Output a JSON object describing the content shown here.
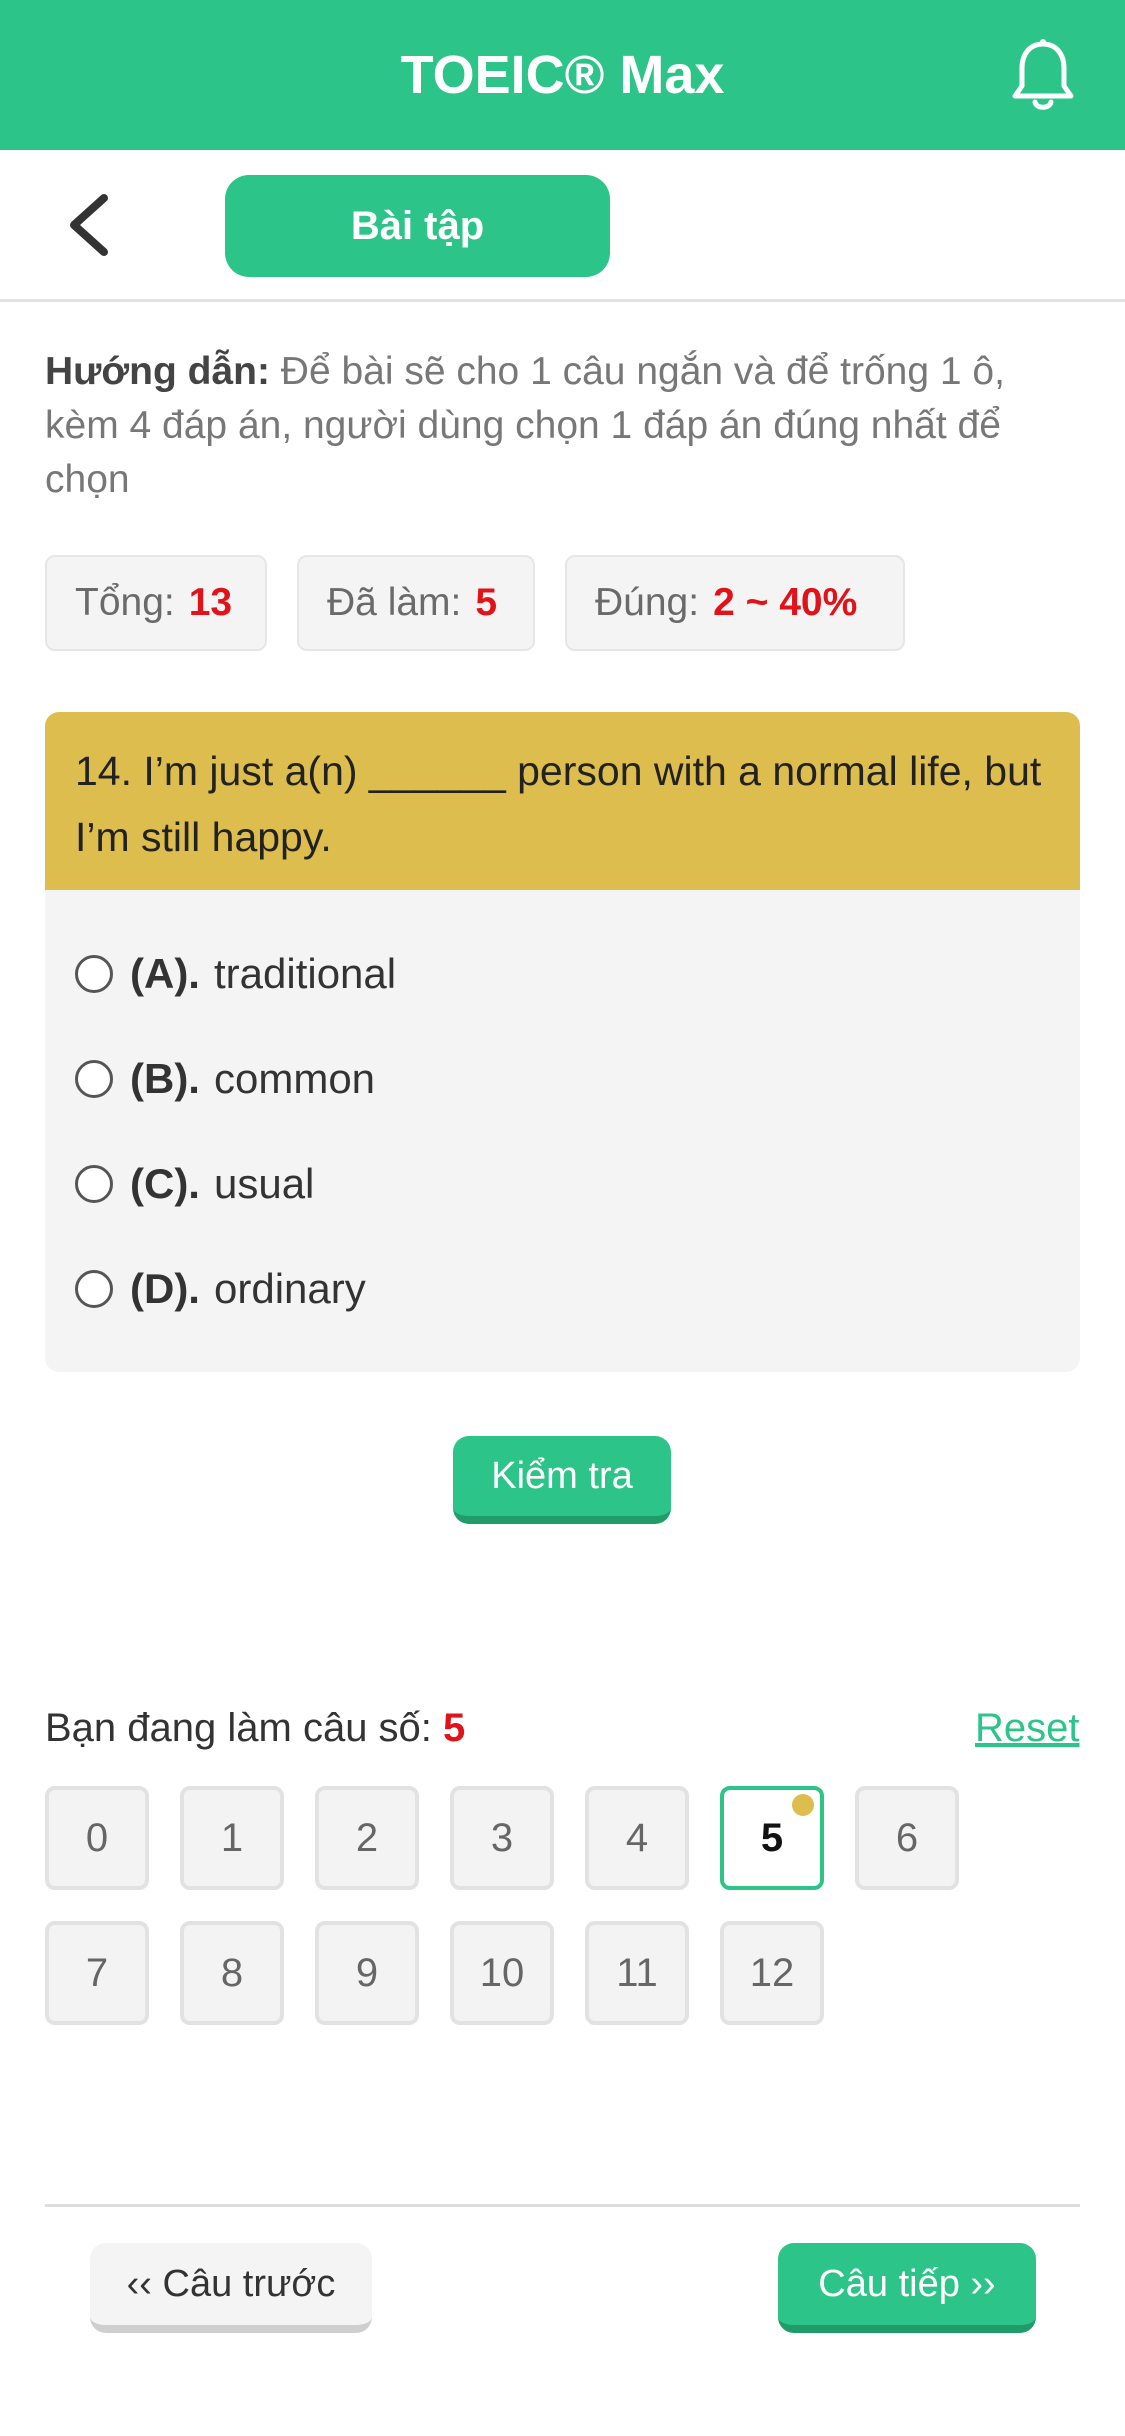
{
  "app": {
    "title": "TOEIC® Max",
    "bell_icon": "bell-icon",
    "accent_color": "#2dc489",
    "highlight_color": "#dcbd4e",
    "error_color": "#e0131a"
  },
  "subheader": {
    "back_icon": "chevron-left-icon",
    "tab_label": "Bài tập"
  },
  "instructions": {
    "label": "Hướng dẫn:",
    "text": " Để bài sẽ cho 1 câu ngắn và để trống 1 ô, kèm 4 đáp án, người dùng chọn 1 đáp án đúng nhất để chọn"
  },
  "stats": {
    "total_label": "Tổng:",
    "total_value": "13",
    "done_label": "Đã làm:",
    "done_value": "5",
    "correct_label": "Đúng:",
    "correct_value": "2 ~ 40%"
  },
  "question": {
    "text": "14. I’m just a(n) ______ person with a normal life, but I’m still happy.",
    "options": [
      {
        "letter": "(A).",
        "text": "traditional"
      },
      {
        "letter": "(B).",
        "text": "common"
      },
      {
        "letter": "(C).",
        "text": "usual"
      },
      {
        "letter": "(D).",
        "text": "ordinary"
      }
    ]
  },
  "check_button": "Kiểm tra",
  "progress": {
    "current_label": "Bạn đang làm câu số:",
    "current_value": "5",
    "reset_label": "Reset",
    "numbers": [
      "0",
      "1",
      "2",
      "3",
      "4",
      "5",
      "6",
      "7",
      "8",
      "9",
      "10",
      "11",
      "12"
    ],
    "active_index": 5
  },
  "nav": {
    "prev_label": "‹‹ Câu trước",
    "next_label": "Câu tiếp ››"
  }
}
